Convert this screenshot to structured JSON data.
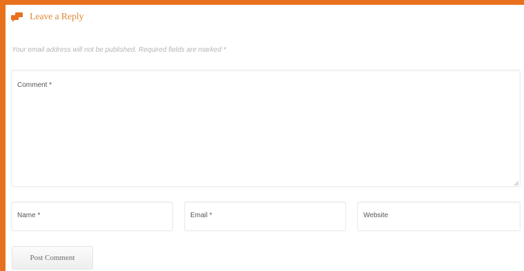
{
  "reply": {
    "title": "Leave a Reply",
    "icon": "comments-icon",
    "accent_color": "#e8711e"
  },
  "notes": {
    "text": "Your email address will not be published. Required fields are marked *"
  },
  "form": {
    "comment_placeholder": "Comment *",
    "name_placeholder": "Name *",
    "email_placeholder": "Email *",
    "website_placeholder": "Website",
    "submit_label": "Post Comment"
  }
}
